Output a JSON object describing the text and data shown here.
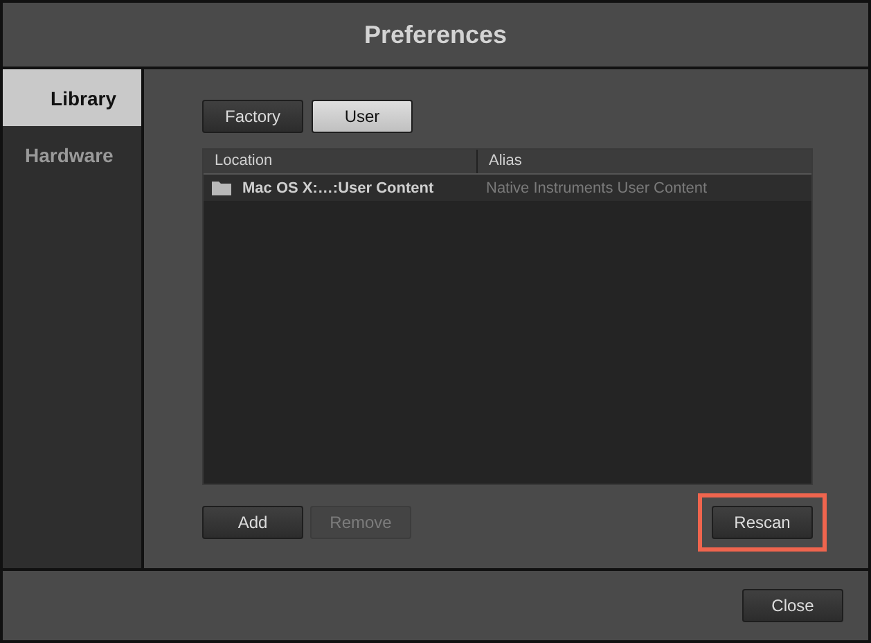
{
  "window": {
    "title": "Preferences"
  },
  "sidebar": {
    "items": [
      {
        "label": "Library",
        "selected": true
      },
      {
        "label": "Hardware",
        "selected": false
      }
    ]
  },
  "tabs": [
    {
      "label": "Factory",
      "selected": false
    },
    {
      "label": "User",
      "selected": true
    }
  ],
  "table": {
    "columns": [
      "Location",
      "Alias"
    ],
    "rows": [
      {
        "location": "Mac OS X:…:User Content",
        "alias": "Native Instruments User Content"
      }
    ]
  },
  "actions": [
    {
      "label": "Add",
      "disabled": false,
      "highlighted": false
    },
    {
      "label": "Remove",
      "disabled": true,
      "highlighted": false
    },
    {
      "label": "Rescan",
      "disabled": false,
      "highlighted": true
    }
  ],
  "buttons": [
    "Close"
  ]
}
